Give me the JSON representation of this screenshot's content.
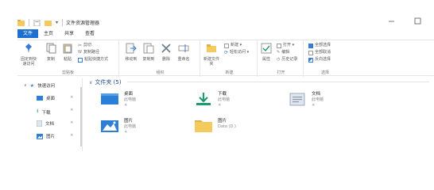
{
  "window": {
    "title": "文件资源管理器",
    "quick_access_dropdown": "▾"
  },
  "tabs": [
    "文件",
    "主页",
    "共享",
    "查看"
  ],
  "ribbon": {
    "clipboard": {
      "label": "剪贴板",
      "pin": "固定到快速访问",
      "copy": "复制",
      "paste": "粘贴",
      "cut": "剪切",
      "copy_path": "复制路径",
      "paste_shortcut": "粘贴快捷方式"
    },
    "organize": {
      "label": "组织",
      "move_to": "移动到",
      "copy_to": "复制到",
      "delete": "删除",
      "rename": "重命名"
    },
    "new": {
      "label": "新建",
      "new_folder": "新建文件夹",
      "new_item": "新建 ▾",
      "easy_access": "轻松访问 ▾"
    },
    "open": {
      "label": "打开",
      "properties": "属性",
      "open": "打开 ▾",
      "edit": "编辑",
      "history": "历史记录"
    },
    "select": {
      "label": "选择",
      "select_all": "全部选择",
      "select_none": "全部取消",
      "invert": "反向选择"
    }
  },
  "nav": {
    "quick_access": "快速访问",
    "items": [
      {
        "label": "桌面",
        "icon": "desktop-icon"
      },
      {
        "label": "下载",
        "icon": "download-icon"
      },
      {
        "label": "文档",
        "icon": "document-icon"
      },
      {
        "label": "图片",
        "icon": "picture-icon"
      }
    ],
    "pin_glyph": "✳"
  },
  "content": {
    "section_title": "文件夹 (5)",
    "folders": [
      {
        "name": "桌面",
        "location": "此电脑",
        "pinned": "✳",
        "icon": "desktop-folder-icon"
      },
      {
        "name": "下载",
        "location": "此电脑",
        "pinned": "✳",
        "icon": "download-folder-icon"
      },
      {
        "name": "文档",
        "location": "此电脑",
        "pinned": "✳",
        "icon": "document-folder-icon"
      },
      {
        "name": "图片",
        "location": "此电脑",
        "pinned": "✳",
        "icon": "picture-folder-icon"
      },
      {
        "name": "图片",
        "location": "Data (D:)",
        "pinned": "",
        "icon": "folder-icon"
      }
    ]
  },
  "colors": {
    "accent": "#1e6fd0",
    "folder_yellow": "#f4c95d",
    "folder_blue": "#2b7fd6",
    "download_green": "#1f9a6b"
  }
}
